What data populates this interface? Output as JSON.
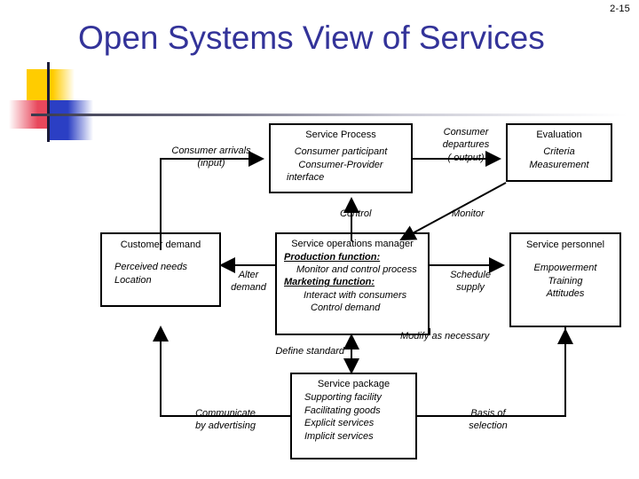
{
  "slide": {
    "page_number": "2-15",
    "title": "Open Systems View of Services",
    "title_color": "#333399"
  },
  "diagram": {
    "type": "flowchart",
    "boxes": [
      {
        "id": "service-process",
        "title": "Service Process",
        "lines": [
          "Consumer participant",
          "Consumer-Provider",
          "interface"
        ]
      },
      {
        "id": "evaluation",
        "title": "Evaluation",
        "lines": [
          "Criteria",
          "Measurement"
        ]
      },
      {
        "id": "customer-demand",
        "title": "Customer demand",
        "lines": [
          "Perceived needs",
          "Location"
        ]
      },
      {
        "id": "service-operations-manager",
        "title": "Service operations manager",
        "headings": [
          {
            "head": "Production function:",
            "sub": "Monitor and control process"
          },
          {
            "head": "Marketing function:",
            "sub": [
              "Interact with consumers",
              "Control demand"
            ]
          }
        ]
      },
      {
        "id": "service-personnel",
        "title": "Service personnel",
        "lines": [
          "Empowerment",
          "Training",
          "Attitudes"
        ]
      },
      {
        "id": "service-package",
        "title": "Service package",
        "lines": [
          "Supporting facility",
          "Facilitating goods",
          "Explicit services",
          "Implicit services"
        ]
      }
    ],
    "labels": [
      {
        "id": "consumer-arrivals",
        "lines": [
          "Consumer  arrivals",
          "(input)"
        ]
      },
      {
        "id": "consumer-departures",
        "lines": [
          "Consumer",
          "departures",
          "( output)"
        ]
      },
      {
        "id": "control",
        "lines": [
          "Control"
        ]
      },
      {
        "id": "monitor",
        "lines": [
          "Monitor"
        ]
      },
      {
        "id": "alter-demand",
        "lines": [
          "Alter",
          "demand"
        ]
      },
      {
        "id": "schedule-supply",
        "lines": [
          "Schedule",
          "supply"
        ]
      },
      {
        "id": "modify-as-necessary",
        "lines": [
          "Modify as necessary"
        ]
      },
      {
        "id": "define-standard",
        "lines": [
          "Define standard"
        ]
      },
      {
        "id": "communicate-by-advertising",
        "lines": [
          "Communicate",
          "by advertising"
        ]
      },
      {
        "id": "basis-of-selection",
        "lines": [
          "Basis of",
          "selection"
        ]
      }
    ]
  }
}
